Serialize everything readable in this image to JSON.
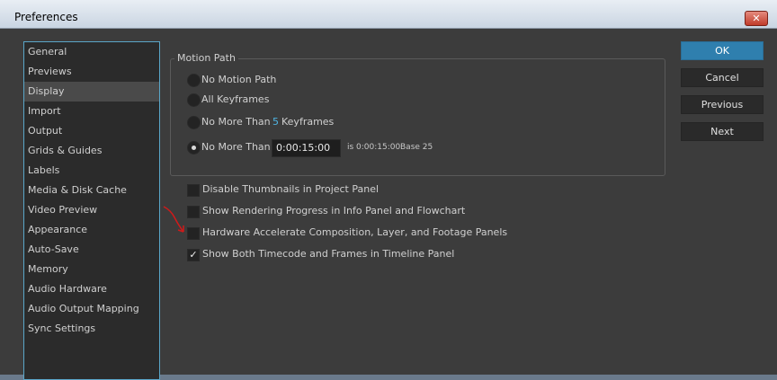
{
  "window": {
    "title": "Preferences",
    "close_label": "✕"
  },
  "sidebar": {
    "items": [
      {
        "label": "General"
      },
      {
        "label": "Previews"
      },
      {
        "label": "Display"
      },
      {
        "label": "Import"
      },
      {
        "label": "Output"
      },
      {
        "label": "Grids & Guides"
      },
      {
        "label": "Labels"
      },
      {
        "label": "Media & Disk Cache"
      },
      {
        "label": "Video Preview"
      },
      {
        "label": "Appearance"
      },
      {
        "label": "Auto-Save"
      },
      {
        "label": "Memory"
      },
      {
        "label": "Audio Hardware"
      },
      {
        "label": "Audio Output Mapping"
      },
      {
        "label": "Sync Settings"
      }
    ],
    "selected": "Display"
  },
  "motion_path": {
    "legend": "Motion Path",
    "options": [
      {
        "label": "No Motion Path",
        "selected": false
      },
      {
        "label": "All Keyframes",
        "selected": false
      },
      {
        "label": "No More Than",
        "value": "5",
        "suffix": "Keyframes",
        "selected": false
      },
      {
        "label": "No More Than",
        "selected": true
      }
    ],
    "timecode_value": "0:00:15:00",
    "timecode_info": "is 0:00:15:00",
    "base_info": "Base 25"
  },
  "checkboxes": [
    {
      "label": "Disable Thumbnails in Project Panel",
      "checked": false,
      "mark": ""
    },
    {
      "label": "Show Rendering Progress in Info Panel and Flowchart",
      "checked": false,
      "mark": ""
    },
    {
      "label": "Hardware Accelerate Composition, Layer, and Footage Panels",
      "checked": false,
      "mark": ""
    },
    {
      "label": "Show Both Timecode and Frames in Timeline Panel",
      "checked": true,
      "mark": "✓"
    }
  ],
  "buttons": {
    "ok": "OK",
    "cancel": "Cancel",
    "previous": "Previous",
    "next": "Next"
  },
  "colors": {
    "accent": "#2f7fae",
    "link": "#4fb5e3",
    "annotation_arrow": "#d11a1a"
  }
}
